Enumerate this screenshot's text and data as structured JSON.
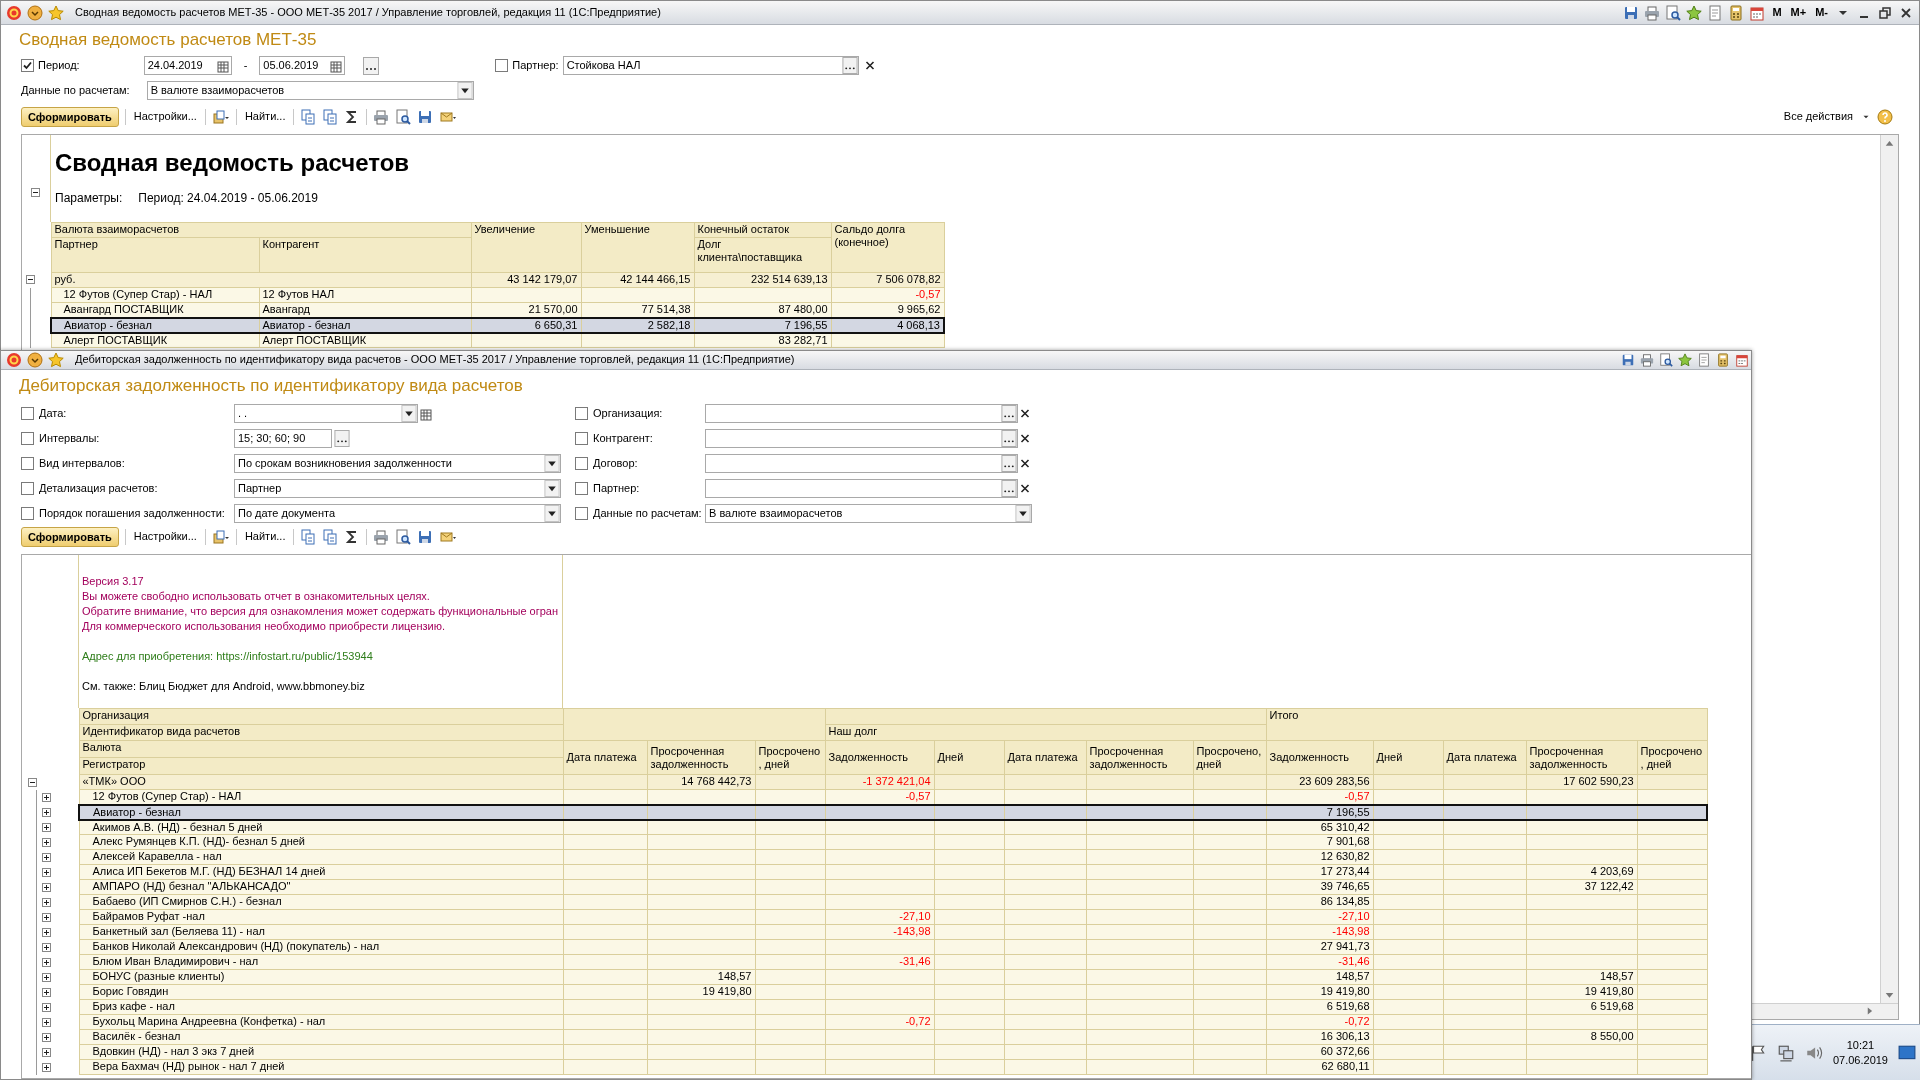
{
  "main_window": {
    "title": "Сводная ведомость расчетов МЕТ-35 - ООО МЕТ-35 2017 / Управление торговлей, редакция 11 (1С:Предприятие)",
    "memory_buttons": [
      "M",
      "M+",
      "M-"
    ],
    "form_title": "Сводная ведомость расчетов МЕТ-35",
    "period": {
      "label": "Период:",
      "checked": true,
      "from": "24.04.2019",
      "dash": "-",
      "to": "05.06.2019"
    },
    "partner": {
      "label": "Партнер:",
      "checked": false,
      "value": "Стойкова НАЛ"
    },
    "data_by": {
      "label": "Данные по расчетам:",
      "value": "В валюте взаиморасчетов"
    },
    "toolbar": {
      "generate": "Сформировать",
      "settings": "Настройки...",
      "find": "Найти...",
      "all_actions": "Все действия"
    },
    "report": {
      "title": "Сводная ведомость расчетов",
      "params_label": "Параметры:",
      "params_value": "Период: 24.04.2019 - 05.06.2019",
      "columns": {
        "currency": "Валюта взаиморасчетов",
        "partner": "Партнер",
        "counterparty": "Контрагент",
        "increase": "Увеличение",
        "decrease": "Уменьшение",
        "end_balance": "Конечный остаток",
        "end_balance_sub": "Долг клиента\\поставщика",
        "debt_balance": "Сальдо долга (конечное)"
      },
      "rows": [
        {
          "label": "руб.",
          "expanded": true,
          "selected": false,
          "increase": "43 142 179,07",
          "decrease": "42 144 466,15",
          "end_balance": "232 514 639,13",
          "debt_balance": "7 506 078,82",
          "children": [
            {
              "partner": "12 Футов (Супер Стар) - НАЛ",
              "counterparty": "12 Футов НАЛ",
              "debt_balance": "-0,57",
              "selected": false
            },
            {
              "partner": "Авангард ПОСТАВЩИК",
              "counterparty": "Авангард",
              "increase": "21 570,00",
              "decrease": "77 514,38",
              "end_balance": "87 480,00",
              "debt_balance": "9 965,62",
              "selected": false
            },
            {
              "partner": "Авиатор - безнал",
              "counterparty": "Авиатор - безнал",
              "increase": "6 650,31",
              "decrease": "2 582,18",
              "end_balance": "7 196,55",
              "debt_balance": "4 068,13",
              "selected": true
            },
            {
              "partner": "Алерт ПОСТАВЩИК",
              "counterparty": "Алерт ПОСТАВЩИК",
              "end_balance": "83 282,71",
              "selected": false
            }
          ]
        }
      ]
    }
  },
  "second_window": {
    "title": "Дебиторская задолженность по идентификатору вида расчетов - ООО МЕТ-35 2017 / Управление торговлей, редакция 11 (1С:Предприятие)",
    "form_title": "Дебиторская задолженность по идентификатору вида расчетов",
    "filters_left": [
      {
        "kind": "date",
        "label": "Дата:",
        "checked": false,
        "value": ". ."
      },
      {
        "kind": "choice",
        "label": "Интервалы:",
        "checked": false,
        "value": "15; 30; 60; 90"
      },
      {
        "kind": "select",
        "label": "Вид интервалов:",
        "checked": false,
        "value": "По срокам возникновения задолженности"
      },
      {
        "kind": "select",
        "label": "Детализация расчетов:",
        "checked": false,
        "value": "Партнер"
      },
      {
        "kind": "select",
        "label": "Порядок погашения задолженности:",
        "checked": false,
        "value": "По дате документа"
      }
    ],
    "filters_right": [
      {
        "kind": "picker",
        "label": "Организация:",
        "checked": false
      },
      {
        "kind": "picker",
        "label": "Контрагент:",
        "checked": false
      },
      {
        "kind": "picker",
        "label": "Договор:",
        "checked": false
      },
      {
        "kind": "picker",
        "label": "Партнер:",
        "checked": false
      },
      {
        "kind": "select",
        "label": "Данные по расчетам:",
        "checked": false,
        "value": "В валюте взаиморасчетов"
      }
    ],
    "toolbar": {
      "generate": "Сформировать",
      "settings": "Настройки...",
      "find": "Найти..."
    },
    "notice": [
      {
        "kind": "version",
        "text": "Версия 3.17"
      },
      {
        "kind": "warning",
        "text": "Вы можете свободно использовать отчет в ознакомительных целях."
      },
      {
        "kind": "warning",
        "text": "Обратите внимание, что версия для ознакомления может содержать функциональные огран"
      },
      {
        "kind": "warning",
        "text": "Для коммерческого использования необходимо приобрести лицензию."
      },
      {
        "kind": "link",
        "text": "Адрес для приобретения: https://infostart.ru/public/153944"
      },
      {
        "kind": "info",
        "text": "См. также: Блиц Бюджет для Android, www.bbmoney.biz"
      }
    ],
    "header": {
      "row_labels": [
        "Организация",
        "Идентификатор вида расчетов",
        "Валюта",
        "Регистратор"
      ],
      "groups": [
        {
          "kind": "plain",
          "columns": [
            "Дата платежа",
            "Просроченная задолженность",
            "Просрочено, дней"
          ]
        },
        {
          "kind": "section",
          "title": "Наш долг",
          "columns": [
            "Задолженность",
            "Дней",
            "Дата платежа",
            "Просроченная задолженность",
            "Просрочено, дней"
          ]
        },
        {
          "kind": "total",
          "title": "Итого",
          "columns": [
            "Задолженность",
            "Дней",
            "Дата платежа",
            "Просроченная задолженность",
            "Просрочено, дней"
          ]
        }
      ]
    },
    "rows": [
      {
        "label": "«ТМК» ООО",
        "expanded": true,
        "selected": false,
        "overdue_debt": "14 768 442,73",
        "our_debt": "-1 372 421,04",
        "total_debt": "23 609 283,56",
        "total_overdue_debt": "17 602 590,23",
        "children": [
          {
            "label": "12 Футов (Супер Стар) - НАЛ",
            "expanded": false,
            "selected": false,
            "our_debt": "-0,57",
            "total_debt": "-0,57"
          },
          {
            "label": "Авиатор - безнал",
            "expanded": false,
            "selected": true,
            "total_debt": "7 196,55"
          },
          {
            "label": "Акимов А.В. (НД) - безнал 5 дней",
            "expanded": false,
            "selected": false,
            "total_debt": "65 310,42"
          },
          {
            "label": "Алекс Румянцев К.П. (НД)- безнал 5 дней",
            "expanded": false,
            "selected": false,
            "total_debt": "7 901,68"
          },
          {
            "label": "Алексей Каравелла - нал",
            "expanded": false,
            "selected": false,
            "total_debt": "12 630,82"
          },
          {
            "label": "Алиса ИП Бекетов М.Г. (НД) БЕЗНАЛ  14 дней",
            "expanded": false,
            "selected": false,
            "total_debt": "17 273,44",
            "total_overdue_debt": "4 203,69"
          },
          {
            "label": "АМПАРО (НД) безнал \"АЛЬКАНСАДО\"",
            "expanded": false,
            "selected": false,
            "total_debt": "39 746,65",
            "total_overdue_debt": "37 122,42"
          },
          {
            "label": "Бабаево (ИП Смирнов С.Н.) - безнал",
            "expanded": false,
            "selected": false,
            "total_debt": "86 134,85"
          },
          {
            "label": "Байрамов Руфат -нал",
            "expanded": false,
            "selected": false,
            "our_debt": "-27,10",
            "total_debt": "-27,10"
          },
          {
            "label": "Банкетный зал (Беляева 11) - нал",
            "expanded": false,
            "selected": false,
            "our_debt": "-143,98",
            "total_debt": "-143,98"
          },
          {
            "label": "Банков Николай Александрович (НД) (покупатель) - нал",
            "expanded": false,
            "selected": false,
            "total_debt": "27 941,73"
          },
          {
            "label": "Блюм Иван Владимирович - нал",
            "expanded": false,
            "selected": false,
            "our_debt": "-31,46",
            "total_debt": "-31,46"
          },
          {
            "label": "БОНУС (разные клиенты)",
            "expanded": false,
            "selected": false,
            "overdue_debt": "148,57",
            "total_debt": "148,57",
            "total_overdue_debt": "148,57"
          },
          {
            "label": "Борис Говядин",
            "expanded": false,
            "selected": false,
            "overdue_debt": "19 419,80",
            "total_debt": "19 419,80",
            "total_overdue_debt": "19 419,80"
          },
          {
            "label": "Бриз кафе - нал",
            "expanded": false,
            "selected": false,
            "total_debt": "6 519,68",
            "total_overdue_debt": "6 519,68"
          },
          {
            "label": "Бухольц Марина Андреевна (Конфетка) - нал",
            "expanded": false,
            "selected": false,
            "our_debt": "-0,72",
            "total_debt": "-0,72"
          },
          {
            "label": "Василёк - безнал",
            "expanded": false,
            "selected": false,
            "total_debt": "16 306,13",
            "total_overdue_debt": "8 550,00"
          },
          {
            "label": "Вдовкин (НД) - нал 3 экз 7 дней",
            "expanded": false,
            "selected": false,
            "total_debt": "60 372,66"
          },
          {
            "label": "Вера Бахмач (НД) рынок - нал 7 дней",
            "expanded": false,
            "selected": false,
            "total_debt": "62 680,11"
          }
        ]
      }
    ]
  },
  "tray": {
    "time": "10:21",
    "date": "07.06.2019"
  }
}
